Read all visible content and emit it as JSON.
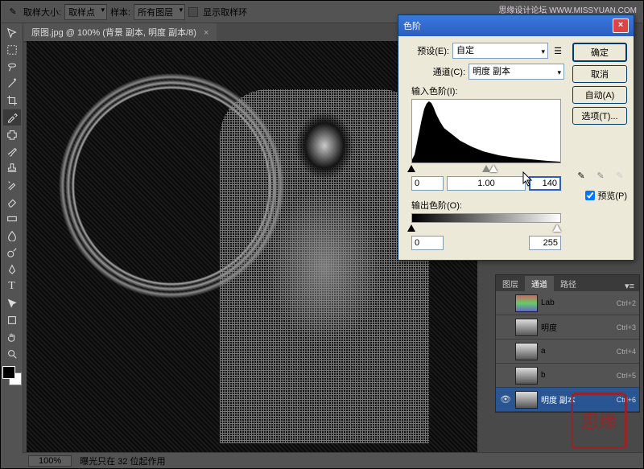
{
  "watermark": "思缘设计论坛  WWW.MISSYUAN.COM",
  "options_bar": {
    "sample_size_label": "取样大小:",
    "sample_size_value": "取样点",
    "sample_label": "样本:",
    "sample_value": "所有图层",
    "show_ring_label": "显示取样环"
  },
  "document": {
    "tab_title": "原图.jpg @ 100% (背景 副本, 明度 副本/8)",
    "zoom": "100%",
    "status": "曝光只在 32 位起作用"
  },
  "levels": {
    "title": "色阶",
    "preset_label": "预设(E):",
    "preset_value": "自定",
    "channel_label": "通道(C):",
    "channel_value": "明度 副本",
    "input_label": "输入色阶(I):",
    "in_black": "0",
    "in_gamma": "1.00",
    "in_white": "140",
    "output_label": "输出色阶(O):",
    "out_black": "0",
    "out_white": "255",
    "ok": "确定",
    "cancel": "取消",
    "auto": "自动(A)",
    "options": "选项(T)...",
    "preview": "预览(P)"
  },
  "panels": {
    "tab_layers": "图层",
    "tab_channels": "通道",
    "tab_paths": "路径",
    "channels": [
      {
        "name": "Lab",
        "shortcut": "Ctrl+2",
        "eye": false,
        "thumb": "lab"
      },
      {
        "name": "明度",
        "shortcut": "Ctrl+3",
        "eye": false,
        "thumb": "gray"
      },
      {
        "name": "a",
        "shortcut": "Ctrl+4",
        "eye": false,
        "thumb": "gray"
      },
      {
        "name": "b",
        "shortcut": "Ctrl+5",
        "eye": false,
        "thumb": "gray"
      },
      {
        "name": "明度 副本",
        "shortcut": "Ctrl+6",
        "eye": true,
        "thumb": "gray",
        "selected": true
      }
    ]
  },
  "seal": "思缘"
}
